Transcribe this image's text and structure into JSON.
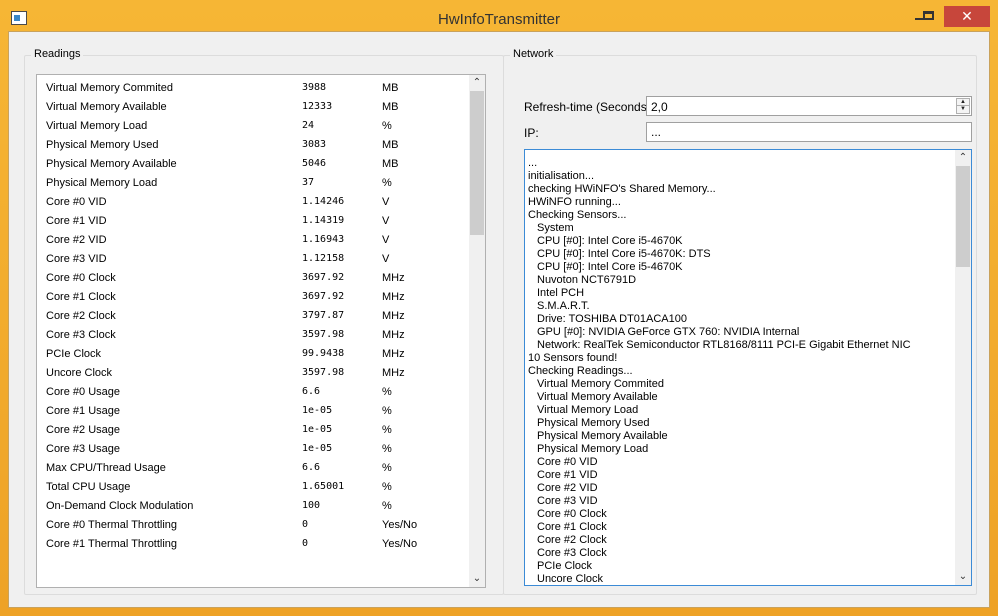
{
  "window": {
    "title": "HwInfoTransmitter",
    "close_glyph": "✕"
  },
  "readings": {
    "group_title": "Readings",
    "rows": [
      {
        "name": "Virtual Memory Commited",
        "value": "3988",
        "unit": "MB"
      },
      {
        "name": "Virtual Memory Available",
        "value": "12333",
        "unit": "MB"
      },
      {
        "name": "Virtual Memory Load",
        "value": "24",
        "unit": "%"
      },
      {
        "name": "Physical Memory Used",
        "value": "3083",
        "unit": "MB"
      },
      {
        "name": "Physical Memory Available",
        "value": "5046",
        "unit": "MB"
      },
      {
        "name": "Physical Memory Load",
        "value": "37",
        "unit": "%"
      },
      {
        "name": "Core #0 VID",
        "value": "1.14246",
        "unit": "V"
      },
      {
        "name": "Core #1 VID",
        "value": "1.14319",
        "unit": "V"
      },
      {
        "name": "Core #2 VID",
        "value": "1.16943",
        "unit": "V"
      },
      {
        "name": "Core #3 VID",
        "value": "1.12158",
        "unit": "V"
      },
      {
        "name": "Core #0 Clock",
        "value": "3697.92",
        "unit": "MHz"
      },
      {
        "name": "Core #1 Clock",
        "value": "3697.92",
        "unit": "MHz"
      },
      {
        "name": "Core #2 Clock",
        "value": "3797.87",
        "unit": "MHz"
      },
      {
        "name": "Core #3 Clock",
        "value": "3597.98",
        "unit": "MHz"
      },
      {
        "name": "PCIe Clock",
        "value": "99.9438",
        "unit": "MHz"
      },
      {
        "name": "Uncore Clock",
        "value": "3597.98",
        "unit": "MHz"
      },
      {
        "name": "Core #0 Usage",
        "value": "6.6",
        "unit": "%"
      },
      {
        "name": "Core #1 Usage",
        "value": "1e-05",
        "unit": "%"
      },
      {
        "name": "Core #2 Usage",
        "value": "1e-05",
        "unit": "%"
      },
      {
        "name": "Core #3 Usage",
        "value": "1e-05",
        "unit": "%"
      },
      {
        "name": "Max CPU/Thread Usage",
        "value": "6.6",
        "unit": "%"
      },
      {
        "name": "Total CPU Usage",
        "value": "1.65001",
        "unit": "%"
      },
      {
        "name": "On-Demand Clock Modulation",
        "value": "100",
        "unit": "%"
      },
      {
        "name": "Core #0 Thermal Throttling",
        "value": "0",
        "unit": "Yes/No"
      },
      {
        "name": "Core #1 Thermal Throttling",
        "value": "0",
        "unit": "Yes/No"
      }
    ],
    "scroll": {
      "up_glyph": "⌃",
      "down_glyph": "⌄",
      "position": 0.0,
      "visible_fraction": 0.3
    }
  },
  "network": {
    "group_title": "Network",
    "refresh_label": "Refresh-time (Seconds):",
    "refresh_value": "2,0",
    "ip_label": "IP:",
    "ip_value": "...",
    "log": [
      {
        "text": "...",
        "indent": false
      },
      {
        "text": "initialisation...",
        "indent": false
      },
      {
        "text": "checking HWiNFO's Shared Memory...",
        "indent": false
      },
      {
        "text": "HWiNFO running...",
        "indent": false
      },
      {
        "text": "Checking Sensors...",
        "indent": false
      },
      {
        "text": "System",
        "indent": true
      },
      {
        "text": "CPU [#0]: Intel Core i5-4670K",
        "indent": true
      },
      {
        "text": "CPU [#0]: Intel Core i5-4670K: DTS",
        "indent": true
      },
      {
        "text": "CPU [#0]: Intel Core i5-4670K",
        "indent": true
      },
      {
        "text": "Nuvoton NCT6791D",
        "indent": true
      },
      {
        "text": "Intel PCH",
        "indent": true
      },
      {
        "text": "S.M.A.R.T.",
        "indent": true
      },
      {
        "text": "Drive: TOSHIBA DT01ACA100",
        "indent": true
      },
      {
        "text": "GPU [#0]: NVIDIA GeForce GTX 760: NVIDIA Internal",
        "indent": true
      },
      {
        "text": "Network: RealTek Semiconductor RTL8168/8111 PCI-E Gigabit Ethernet NIC",
        "indent": true
      },
      {
        "text": "10 Sensors found!",
        "indent": false
      },
      {
        "text": "Checking Readings...",
        "indent": false
      },
      {
        "text": "Virtual Memory Commited",
        "indent": true
      },
      {
        "text": "Virtual Memory Available",
        "indent": true
      },
      {
        "text": "Virtual Memory Load",
        "indent": true
      },
      {
        "text": "Physical Memory Used",
        "indent": true
      },
      {
        "text": "Physical Memory Available",
        "indent": true
      },
      {
        "text": "Physical Memory Load",
        "indent": true
      },
      {
        "text": "Core #0 VID",
        "indent": true
      },
      {
        "text": "Core #1 VID",
        "indent": true
      },
      {
        "text": "Core #2 VID",
        "indent": true
      },
      {
        "text": "Core #3 VID",
        "indent": true
      },
      {
        "text": "Core #0 Clock",
        "indent": true
      },
      {
        "text": "Core #1 Clock",
        "indent": true
      },
      {
        "text": "Core #2 Clock",
        "indent": true
      },
      {
        "text": "Core #3 Clock",
        "indent": true
      },
      {
        "text": "PCIe Clock",
        "indent": true
      },
      {
        "text": "Uncore Clock",
        "indent": true
      }
    ],
    "scroll": {
      "up_glyph": "⌃",
      "down_glyph": "⌄",
      "position": 0.0,
      "visible_fraction": 0.25
    }
  },
  "colors": {
    "title_bar": "#f6b635",
    "close_button": "#c7463b",
    "log_border": "#3c8bd6"
  }
}
